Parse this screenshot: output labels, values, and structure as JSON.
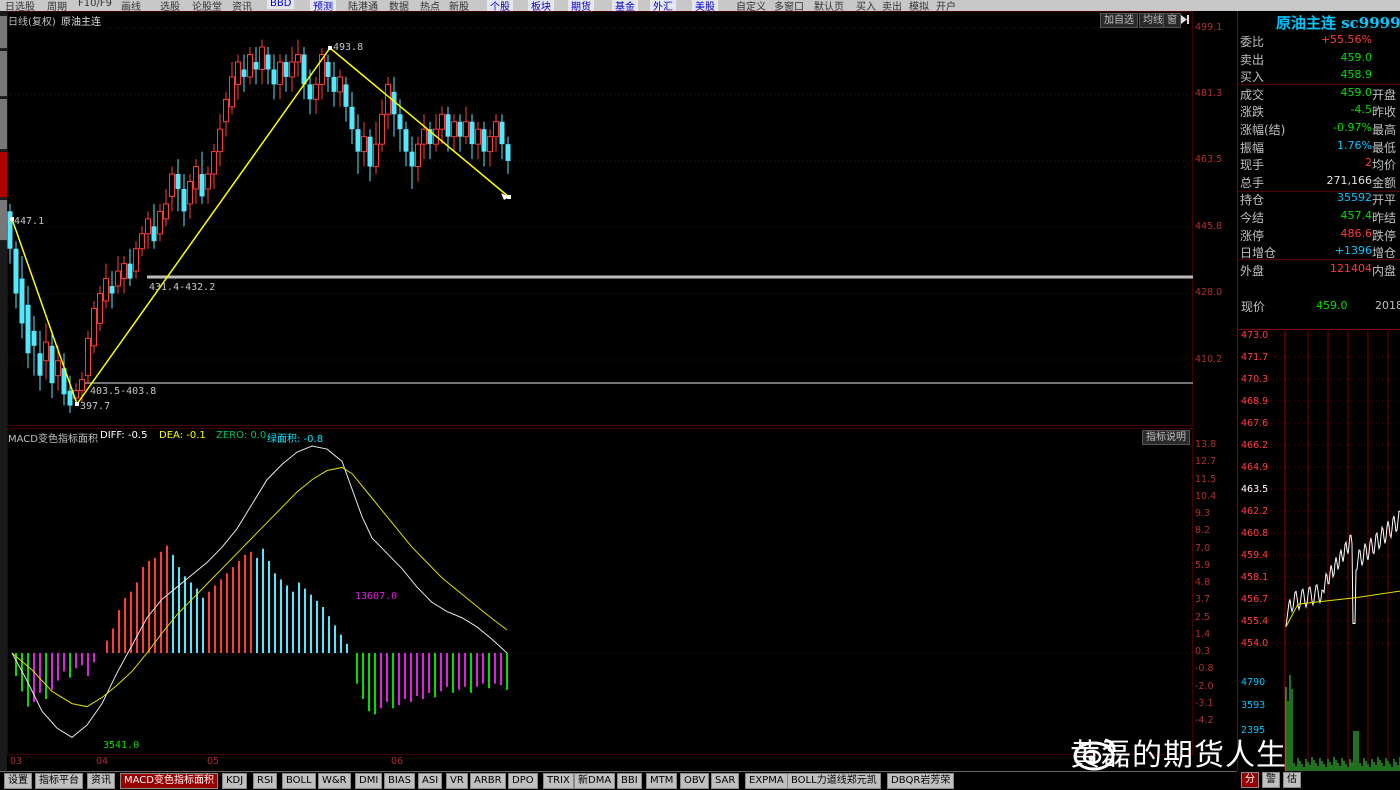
{
  "menu": [
    "日选股",
    "周期",
    "F10/F9",
    "画线",
    "选股",
    "论股堂",
    "资讯",
    "BBD",
    "预测",
    "陆港通",
    "数据",
    "热点",
    "新股",
    "个股",
    "板块",
    "期货",
    "基金",
    "外汇",
    "美股",
    "自定义",
    "多窗口",
    "默认页",
    "买入",
    "卖出",
    "模拟",
    "开户"
  ],
  "main_header": {
    "period": "日线(复权)",
    "name": "原油主连"
  },
  "main_buttons": [
    "加自选",
    "均线",
    "窗"
  ],
  "main_yaxis": [
    "499.1",
    "481.3",
    "463.5",
    "445.8",
    "428.0",
    "410.2"
  ],
  "annotations": {
    "high": "493.8",
    "left_high": "447.1",
    "low": "397.7",
    "band1": "431.4-432.2",
    "band2": "403.5-403.8"
  },
  "macd_header": {
    "name": "MACD变色指标面积",
    "diff": "DIFF: -0.5",
    "dea": "DEA: -0.1",
    "zero": "ZERO: 0.0",
    "area": "绿面积: -0.8"
  },
  "macd_button": "指标说明",
  "macd_labels": {
    "red_area": "13607.0",
    "green_area": "3541.0"
  },
  "macd_yaxis": [
    "13.8",
    "12.7",
    "11.5",
    "10.4",
    "9.3",
    "8.2",
    "7.0",
    "5.9",
    "4.8",
    "3.7",
    "2.5",
    "1.4",
    "0.3",
    "-0.8",
    "-2.0",
    "-3.1",
    "-4.2"
  ],
  "xaxis": [
    "03",
    "04",
    "05",
    "06"
  ],
  "quote": {
    "title": "原油主连 sc9999",
    "rows": [
      {
        "l": "委比",
        "v": "+55.56%",
        "c": "red",
        "l2": ""
      },
      {
        "l": "卖出",
        "v": "459.0",
        "c": "green",
        "l2": ""
      },
      {
        "l": "买入",
        "v": "458.9",
        "c": "green",
        "l2": ""
      },
      {
        "l": "成交",
        "v": "459.0",
        "c": "green",
        "l2": "开盘"
      },
      {
        "l": "涨跌",
        "v": "-4.5",
        "c": "green",
        "l2": "昨收"
      },
      {
        "l": "涨幅(结)",
        "v": "-0.97%",
        "c": "green",
        "l2": "最高"
      },
      {
        "l": "振幅",
        "v": "1.76%",
        "c": "cyan",
        "l2": "最低"
      },
      {
        "l": "现手",
        "v": "2",
        "c": "red",
        "l2": "均价"
      },
      {
        "l": "总手",
        "v": "271,166",
        "c": "white",
        "l2": "金额"
      },
      {
        "l": "持仓",
        "v": "35592",
        "c": "cyan",
        "l2": "开平"
      },
      {
        "l": "今结",
        "v": "457.4",
        "c": "green",
        "l2": "昨结"
      },
      {
        "l": "涨停",
        "v": "486.6",
        "c": "red",
        "l2": "跌停"
      },
      {
        "l": "日增仓",
        "v": "+1396",
        "c": "cyan",
        "l2": "增仓"
      },
      {
        "l": "外盘",
        "v": "121404",
        "c": "red",
        "l2": "内盘"
      }
    ],
    "price_label": "现价",
    "price": "459.0",
    "time": "2018"
  },
  "mini_prices": [
    "473.0",
    "471.7",
    "470.3",
    "468.9",
    "467.6",
    "466.2",
    "464.9",
    "463.5",
    "462.2",
    "460.8",
    "459.4",
    "458.1",
    "456.7",
    "455.4",
    "454.0"
  ],
  "mini_vols": [
    "4790",
    "3593",
    "2395"
  ],
  "bottom_tabs": [
    "设置",
    "指标平台",
    "资讯",
    "MACD变色指标面积",
    "KDJ",
    "RSI",
    "BOLL",
    "W&R",
    "DMI",
    "BIAS",
    "ASI",
    "VR",
    "ARBR",
    "DPO",
    "TRIX",
    "新DMA",
    "BBI",
    "MTM",
    "OBV",
    "SAR",
    "EXPMA",
    "BOLL力道线郑元凯",
    "DBQR岩芳荣"
  ],
  "right_tabs": [
    "分",
    "警",
    "估"
  ],
  "watermark": "黄磊的期货人生",
  "colors": {
    "up": "#ff3b3b",
    "down": "#54e8ff",
    "line": "#ffff00",
    "bg": "#000000"
  }
}
